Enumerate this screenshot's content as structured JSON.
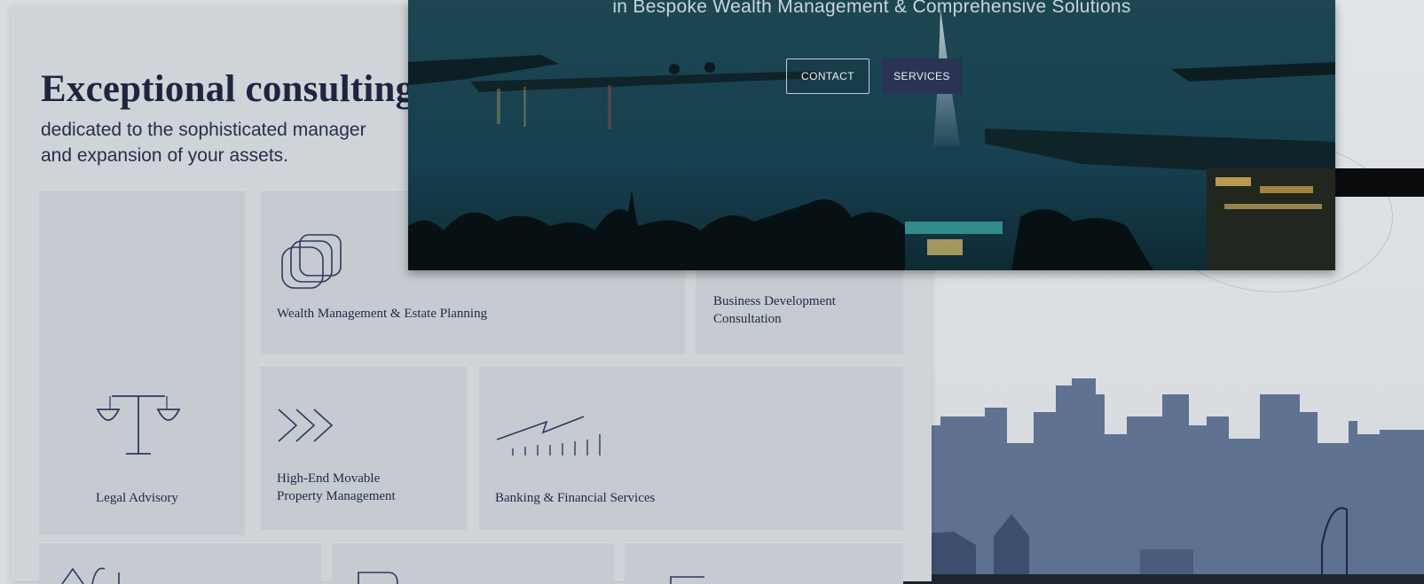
{
  "hero": {
    "tagline": "in Bespoke Wealth Management & Comprehensive Solutions",
    "contact_label": "CONTACT",
    "services_label": "SERVICES"
  },
  "intro": {
    "headline": "Exceptional consulting",
    "subline_1": "dedicated to the sophisticated manager",
    "subline_2": "and expansion of your assets."
  },
  "services": [
    {
      "label": "Wealth Management & Estate Planning",
      "icon": "overlapping-squares-icon"
    },
    {
      "label_1": "Business Development",
      "label_2": "Consultation"
    },
    {
      "label": "Legal Advisory",
      "icon": "scales-icon"
    },
    {
      "label_1": "High-End Movable",
      "label_2": "Property Management",
      "icon": "chevrons-icon"
    },
    {
      "label": "Banking & Financial Services",
      "icon": "growth-chart-icon"
    }
  ],
  "colors": {
    "navy": "#1d2540",
    "button_dark": "#2b3355",
    "paper": "#cfd4d8",
    "skyline": "#5a6b8c"
  }
}
